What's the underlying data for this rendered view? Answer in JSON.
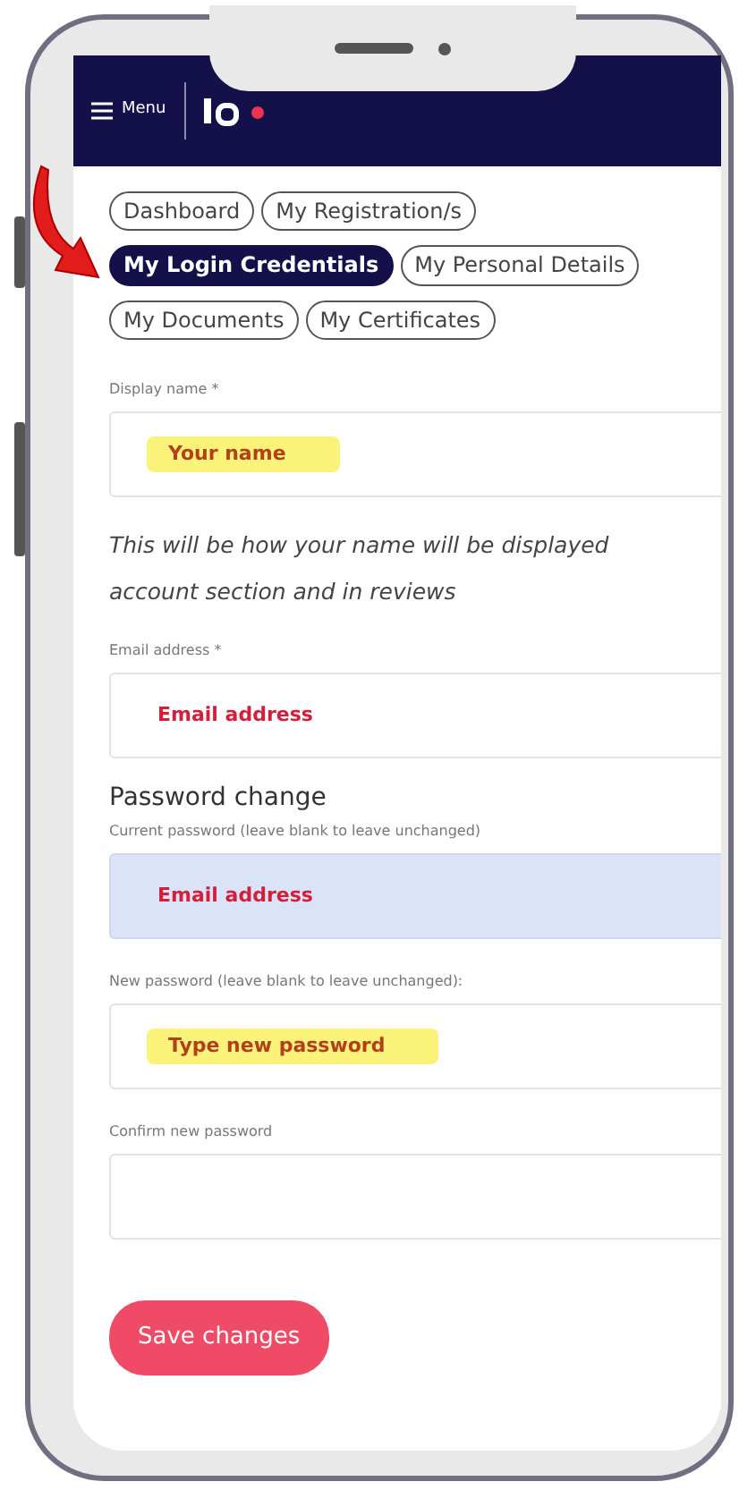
{
  "header": {
    "menu_label": "Menu"
  },
  "tabs": [
    {
      "label": "Dashboard",
      "selected": false
    },
    {
      "label": "My Registration/s",
      "selected": false
    },
    {
      "label": "My Login Credentials",
      "selected": true
    },
    {
      "label": "My Personal Details",
      "selected": false
    },
    {
      "label": "My Documents",
      "selected": false
    },
    {
      "label": "My Certificates",
      "selected": false
    }
  ],
  "form": [
    {
      "kind": "field",
      "label": "Display name *",
      "value": "Your name",
      "highlighted": true,
      "autofilled": false
    },
    {
      "kind": "help",
      "lines": [
        "This will be how your name will be displayed",
        "account section and in reviews"
      ]
    },
    {
      "kind": "field",
      "label": "Email address *",
      "value": "Email address",
      "highlighted": false,
      "autofilled": false
    },
    {
      "kind": "heading",
      "text": "Password change"
    },
    {
      "kind": "field",
      "label": "Current password (leave blank to leave unchanged)",
      "value": "Email address",
      "highlighted": false,
      "autofilled": true
    },
    {
      "kind": "field",
      "label": "New password (leave blank to leave unchanged):",
      "value": "Type new password",
      "highlighted": true,
      "autofilled": false
    },
    {
      "kind": "field",
      "label": "Confirm new password",
      "autofilled": false
    }
  ],
  "save_button": "Save changes"
}
